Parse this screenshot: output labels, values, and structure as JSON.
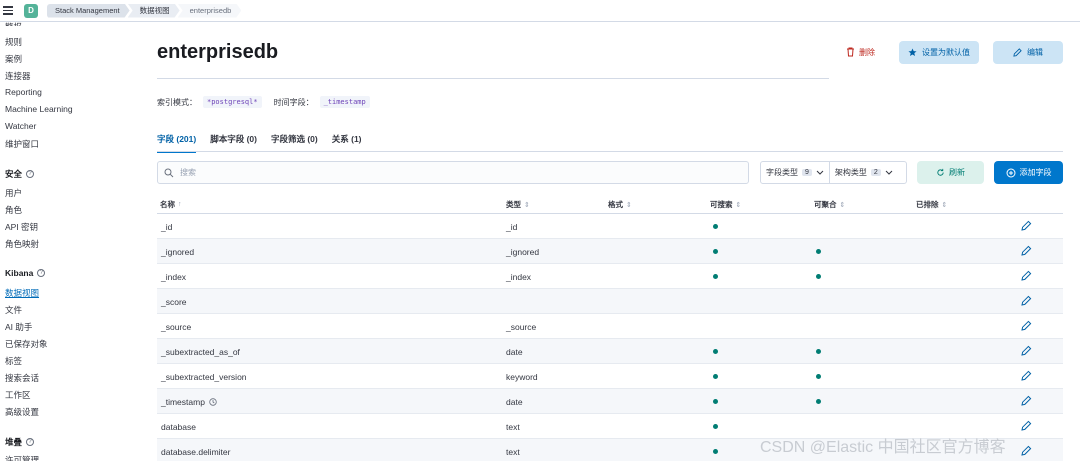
{
  "breadcrumbs": [
    "Stack Management",
    "数据视图",
    "enterprisedb"
  ],
  "space_initial": "D",
  "sidebar": {
    "items_top": [
      "规则",
      "案例",
      "连接器",
      "Reporting",
      "Machine Learning",
      "Watcher",
      "维护窗口"
    ],
    "security_title": "安全",
    "security_items": [
      "用户",
      "角色",
      "API 密钥",
      "角色映射"
    ],
    "kibana_title": "Kibana",
    "kibana_items": [
      "数据视图",
      "文件",
      "AI 助手",
      "已保存对象",
      "标签",
      "搜索会话",
      "工作区",
      "高级设置"
    ],
    "stack_title": "堆叠"
  },
  "page": {
    "title": "enterprisedb",
    "delete_label": "删除",
    "set_default_label": "设置为默认值",
    "edit_label": "编辑",
    "index_pattern_label": "索引模式：",
    "index_pattern_value": "*postgresql*",
    "time_field_label": "时间字段：",
    "time_field_value": "_timestamp"
  },
  "tabs": [
    {
      "label": "字段 (201)",
      "active": true
    },
    {
      "label": "脚本字段 (0)",
      "active": false
    },
    {
      "label": "字段筛选 (0)",
      "active": false
    },
    {
      "label": "关系 (1)",
      "active": false
    }
  ],
  "search": {
    "placeholder": "搜索"
  },
  "filters": [
    {
      "label": "字段类型",
      "count": "9"
    },
    {
      "label": "架构类型",
      "count": "2"
    }
  ],
  "refresh_label": "刷新",
  "add_field_label": "添加字段",
  "table": {
    "columns": [
      "名称",
      "类型",
      "格式",
      "可搜索",
      "可聚合",
      "已排除"
    ],
    "rows": [
      {
        "name": "_id",
        "type": "_id",
        "searchable": true,
        "aggregatable": false,
        "time": false
      },
      {
        "name": "_ignored",
        "type": "_ignored",
        "searchable": true,
        "aggregatable": true,
        "time": false
      },
      {
        "name": "_index",
        "type": "_index",
        "searchable": true,
        "aggregatable": true,
        "time": false
      },
      {
        "name": "_score",
        "type": "",
        "searchable": false,
        "aggregatable": false,
        "time": false
      },
      {
        "name": "_source",
        "type": "_source",
        "searchable": false,
        "aggregatable": false,
        "time": false
      },
      {
        "name": "_subextracted_as_of",
        "type": "date",
        "searchable": true,
        "aggregatable": true,
        "time": false
      },
      {
        "name": "_subextracted_version",
        "type": "keyword",
        "searchable": true,
        "aggregatable": true,
        "time": false
      },
      {
        "name": "_timestamp",
        "type": "date",
        "searchable": true,
        "aggregatable": true,
        "time": true
      },
      {
        "name": "database",
        "type": "text",
        "searchable": true,
        "aggregatable": false,
        "time": false
      },
      {
        "name": "database.delimiter",
        "type": "text",
        "searchable": true,
        "aggregatable": false,
        "time": false
      }
    ]
  },
  "watermark": "CSDN @Elastic 中国社区官方博客",
  "colors": {
    "accent": "#0077cc",
    "success": "#017d73",
    "danger": "#bd271e"
  }
}
